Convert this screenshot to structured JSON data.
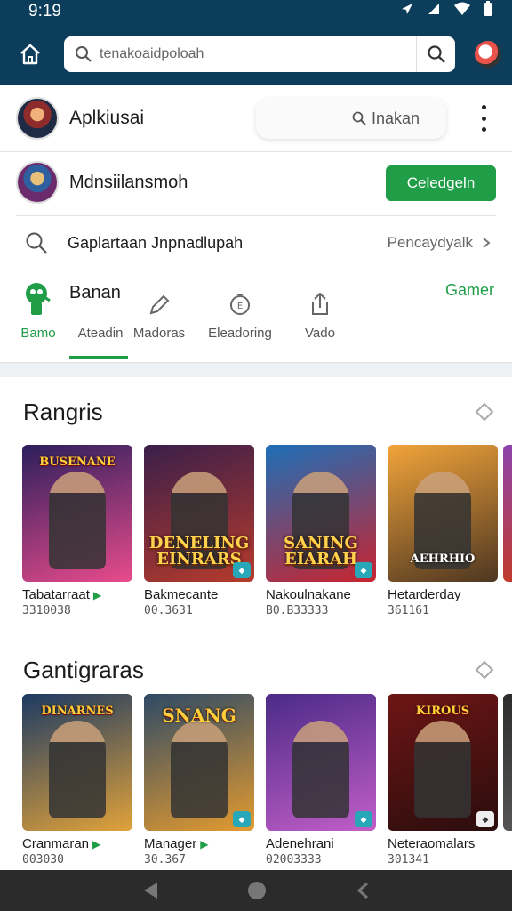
{
  "status_bar": {
    "time": "9:19"
  },
  "app_bar": {
    "search_placeholder": "tenakoaidpoloah"
  },
  "header_row": {
    "title": "Aplkiusai",
    "pill_label": "Inakan"
  },
  "account_row": {
    "title": "Mdnsiilansmoh",
    "button_label": "Celedgeln"
  },
  "search_row": {
    "label": "Gaplartaan Jnpnadlupah",
    "right_label": "Pencaydyalk"
  },
  "tabs_header": {
    "title": "Banan",
    "link": "Gamer"
  },
  "tabs": [
    {
      "label": "Bamo",
      "icon": "game-controller-icon",
      "active": true
    },
    {
      "label": "Ateadin",
      "icon": "",
      "active": false
    },
    {
      "label": "Madoras",
      "icon": "pencil-icon",
      "active": false
    },
    {
      "label": "Eleadoring",
      "icon": "clock-badge-icon",
      "active": false
    },
    {
      "label": "Vado",
      "icon": "share-icon",
      "active": false
    }
  ],
  "sections": [
    {
      "title": "Rangris",
      "items": [
        {
          "name": "Tabatarraat",
          "meta": "3310038",
          "art_top": "BUSENANE",
          "art_text": "",
          "colors": [
            "#2b1f5c",
            "#e94b8c"
          ]
        },
        {
          "name": "Bakmecante",
          "meta": "00.3631",
          "art_top": "",
          "art_text": "DENELING EINRARS",
          "colors": [
            "#3a1f4a",
            "#b63a2c"
          ]
        },
        {
          "name": "Nakoulnakane",
          "meta": "B0.B33333",
          "art_top": "",
          "art_text": "SANING EIARAH",
          "colors": [
            "#1d6fb8",
            "#c9242f"
          ]
        },
        {
          "name": "Hetarderday",
          "meta": "361161",
          "art_top": "",
          "art_text": "AEHRHIO",
          "colors": [
            "#f1a43a",
            "#4e3621"
          ]
        }
      ]
    },
    {
      "title": "Gantigraras",
      "items": [
        {
          "name": "Cranmaran",
          "meta": "003030",
          "art_top": "DINARNES",
          "art_text": "",
          "colors": [
            "#1c3a63",
            "#e1a23a"
          ]
        },
        {
          "name": "Manager",
          "meta": "30.367",
          "art_top": "SNANG",
          "art_text": "",
          "colors": [
            "#2e4a66",
            "#e49b2f"
          ]
        },
        {
          "name": "Adenehrani",
          "meta": "02003333",
          "art_top": "",
          "art_text": "",
          "colors": [
            "#4b2a86",
            "#c25ec9"
          ]
        },
        {
          "name": "Neteraomalars",
          "meta": "301341",
          "art_top": "KIROUS",
          "art_text": "",
          "colors": [
            "#6e1515",
            "#2b0d0d"
          ]
        }
      ]
    }
  ],
  "colors": {
    "primary": "#0c3e5c",
    "accent": "#1f9d47",
    "navbar": "#2b2b2b"
  }
}
